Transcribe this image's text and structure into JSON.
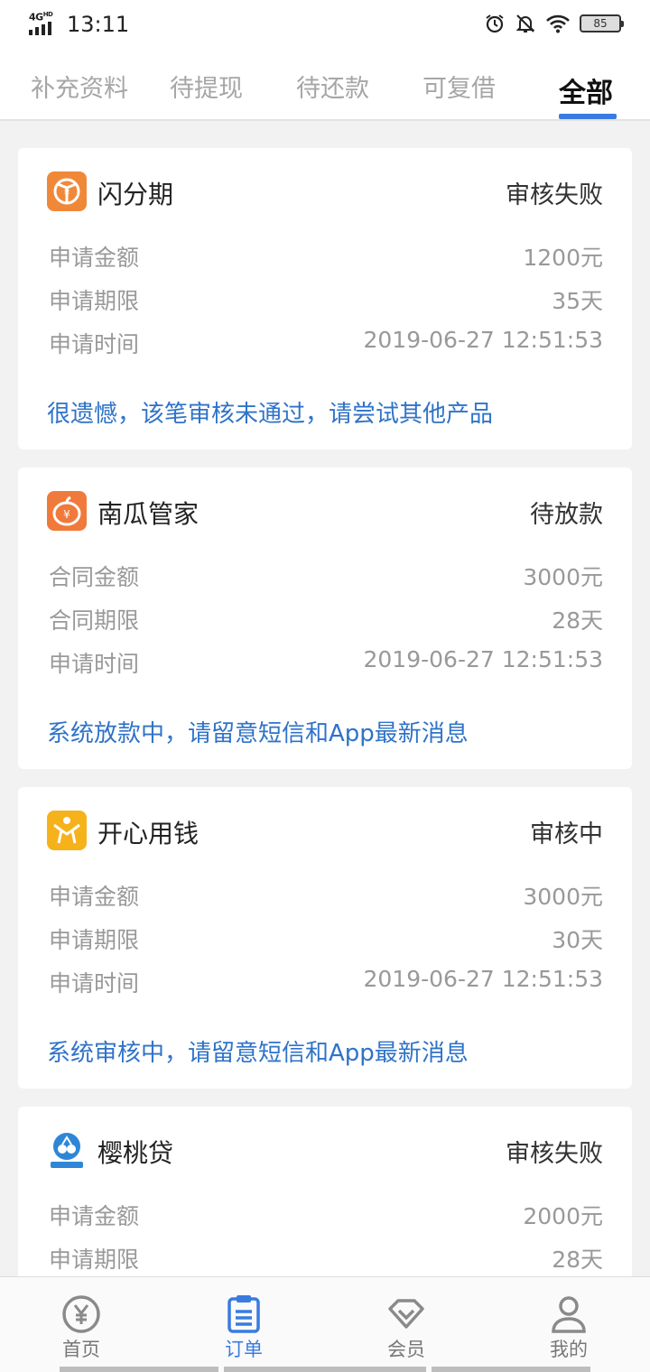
{
  "status_bar": {
    "network": "4G",
    "network_sup": "HD",
    "time": "13:11",
    "battery": "85"
  },
  "tabs": [
    {
      "label": "补充资料",
      "active": false
    },
    {
      "label": "待提现",
      "active": false
    },
    {
      "label": "待还款",
      "active": false
    },
    {
      "label": "可复借",
      "active": false
    },
    {
      "label": "全部",
      "active": true
    }
  ],
  "orders": [
    {
      "app_name": "闪分期",
      "status": "审核失败",
      "rows": [
        {
          "label": "申请金额",
          "value": "1200元"
        },
        {
          "label": "申请期限",
          "value": "35天"
        },
        {
          "label": "申请时间",
          "value": "2019-06-27 12:51:53"
        }
      ],
      "note": "很遗憾，该笔审核未通过，请尝试其他产品",
      "logo": "shanfenqi-logo",
      "logo_color": "#f0883a"
    },
    {
      "app_name": "南瓜管家",
      "status": "待放款",
      "rows": [
        {
          "label": "合同金额",
          "value": "3000元"
        },
        {
          "label": "合同期限",
          "value": "28天"
        },
        {
          "label": "申请时间",
          "value": "2019-06-27 12:51:53"
        }
      ],
      "note": "系统放款中，请留意短信和App最新消息",
      "logo": "pumpkin-logo",
      "logo_color": "#f07a3c"
    },
    {
      "app_name": "开心用钱",
      "status": "审核中",
      "rows": [
        {
          "label": "申请金额",
          "value": "3000元"
        },
        {
          "label": "申请期限",
          "value": "30天"
        },
        {
          "label": "申请时间",
          "value": "2019-06-27 12:51:53"
        }
      ],
      "note": "系统审核中，请留意短信和App最新消息",
      "logo": "happy-people-logo",
      "logo_color": "#f6b21b"
    },
    {
      "app_name": "樱桃贷",
      "status": "审核失败",
      "rows": [
        {
          "label": "申请金额",
          "value": "2000元"
        },
        {
          "label": "申请期限",
          "value": "28天"
        }
      ],
      "logo": "cherry-logo",
      "logo_color": "#2f86d6"
    }
  ],
  "bottom_nav": [
    {
      "label": "首页",
      "icon": "yen-circle-icon",
      "active": false
    },
    {
      "label": "订单",
      "icon": "clipboard-icon",
      "active": true
    },
    {
      "label": "会员",
      "icon": "diamond-icon",
      "active": false
    },
    {
      "label": "我的",
      "icon": "user-icon",
      "active": false
    }
  ],
  "colors": {
    "accent": "#3a7be0",
    "note": "#2f73c8",
    "muted": "#999999"
  }
}
